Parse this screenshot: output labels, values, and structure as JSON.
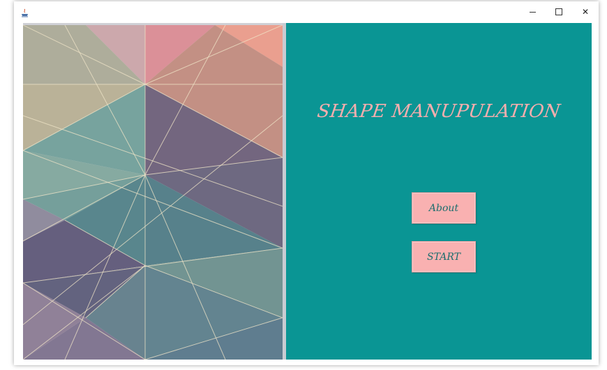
{
  "window": {
    "controls": {
      "minimize_icon": "minimize-icon",
      "maximize_icon": "maximize-icon",
      "close_label": "✕"
    }
  },
  "main": {
    "title": "SHAPE MANUPULATION",
    "buttons": {
      "about": "About",
      "start": "START"
    }
  },
  "colors": {
    "teal_panel": "#0a9594",
    "title_text": "#f7aeae",
    "button_bg": "#f9b1b1",
    "button_text": "#1c6e6e"
  }
}
